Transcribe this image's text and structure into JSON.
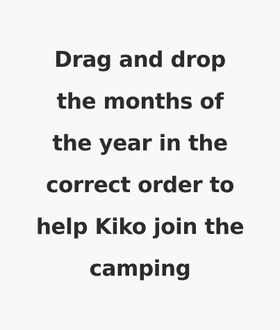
{
  "instruction": {
    "lines": [
      "Drag and drop",
      "the months of",
      "the year in the",
      "correct order to",
      "help Kiko join the",
      "camping"
    ]
  },
  "colors": {
    "background": "#f8f8f8",
    "text": "#2c2c2c"
  }
}
